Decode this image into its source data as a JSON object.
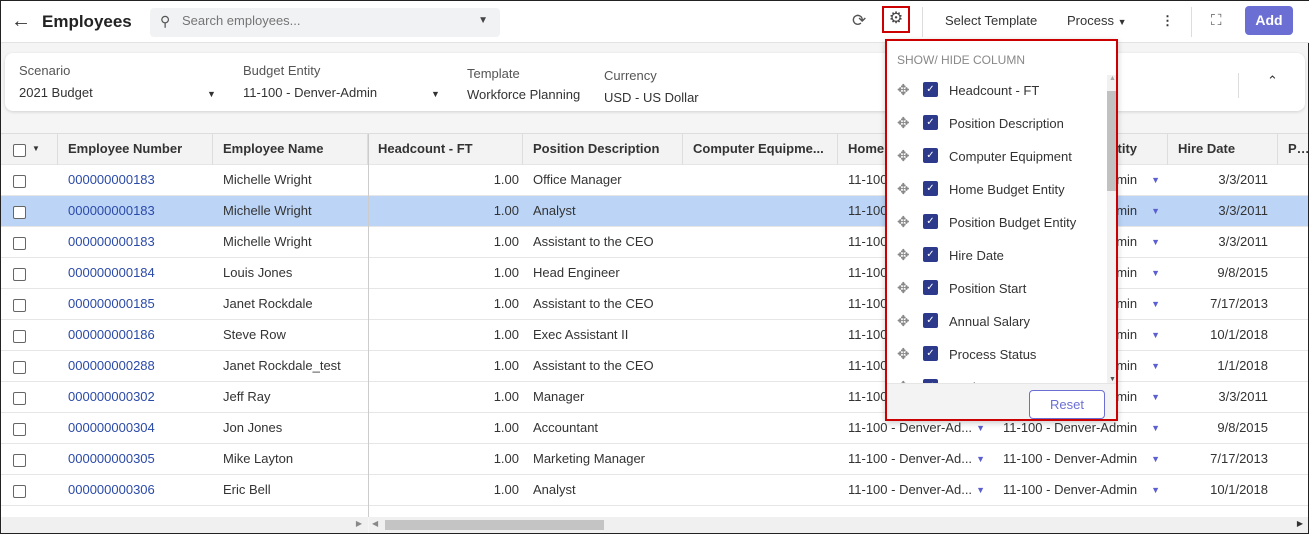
{
  "header": {
    "title": "Employees",
    "search_placeholder": "Search employees...",
    "select_template": "Select Template",
    "process": "Process",
    "add": "Add"
  },
  "filters": {
    "scenario_label": "Scenario",
    "scenario": "2021 Budget",
    "entity_label": "Budget Entity",
    "entity": "11-100 - Denver-Admin",
    "template_label": "Template",
    "template": "Workforce Planning",
    "currency_label": "Currency",
    "currency": "USD - US Dollar"
  },
  "columns": [
    "Employee Number",
    "Employee Name",
    "Headcount - FT",
    "Position Description",
    "Computer Equipme...",
    "Home",
    "tity",
    "Hire Date",
    "Po:"
  ],
  "rows": [
    [
      "000000000183",
      "Michelle Wright",
      "1.00",
      "Office Manager",
      "11-100 - Denver-Ad...",
      "11-100 - Denver-Admin",
      "3/3/2011"
    ],
    [
      "000000000183",
      "Michelle Wright",
      "1.00",
      "Analyst",
      "11-100 - Denver-Ad...",
      "11-100 - Denver-Admin",
      "3/3/2011"
    ],
    [
      "000000000183",
      "Michelle Wright",
      "1.00",
      "Assistant to the CEO",
      "11-100 - Denver-Ad...",
      "11-100 - Denver-Admin",
      "3/3/2011"
    ],
    [
      "000000000184",
      "Louis Jones",
      "1.00",
      "Head Engineer",
      "11-100 - Denver-Ad...",
      "11-100 - Denver-Admin",
      "9/8/2015"
    ],
    [
      "000000000185",
      "Janet Rockdale",
      "1.00",
      "Assistant to the CEO",
      "11-100 - Denver-Ad...",
      "11-100 - Denver-Admin",
      "7/17/2013"
    ],
    [
      "000000000186",
      "Steve Row",
      "1.00",
      "Exec Assistant II",
      "11-100 - Denver-Ad...",
      "11-100 - Denver-Admin",
      "10/1/2018"
    ],
    [
      "000000000288",
      "Janet Rockdale_test",
      "1.00",
      "Assistant to the CEO",
      "11-100 - Denver-Ad...",
      "11-100 - Denver-Admin",
      "1/1/2018"
    ],
    [
      "000000000302",
      "Jeff Ray",
      "1.00",
      "Manager",
      "11-100 - Denver-Ad...",
      "11-100 - Denver-Admin",
      "3/3/2011"
    ],
    [
      "000000000304",
      "Jon Jones",
      "1.00",
      "Accountant",
      "11-100 - Denver-Ad...",
      "11-100 - Denver-Admin",
      "9/8/2015"
    ],
    [
      "000000000305",
      "Mike Layton",
      "1.00",
      "Marketing Manager",
      "11-100 - Denver-Ad...",
      "11-100 - Denver-Admin",
      "7/17/2013"
    ],
    [
      "000000000306",
      "Eric Bell",
      "1.00",
      "Analyst",
      "11-100 - Denver-Ad...",
      "11-100 - Denver-Admin",
      "10/1/2018"
    ]
  ],
  "selected_row": 1,
  "popup": {
    "title": "SHOW/ HIDE COLUMN",
    "items": [
      "Headcount - FT",
      "Position Description",
      "Computer Equipment",
      "Home Budget Entity",
      "Position Budget Entity",
      "Hire Date",
      "Position Start",
      "Annual Salary",
      "Process Status",
      "Region Type"
    ],
    "reset": "Reset"
  },
  "colors": {
    "accent": "#6b6fd4",
    "selected_row": "#bcd5f7",
    "link": "#2b4aa8",
    "highlight_border": "#cc0000"
  }
}
